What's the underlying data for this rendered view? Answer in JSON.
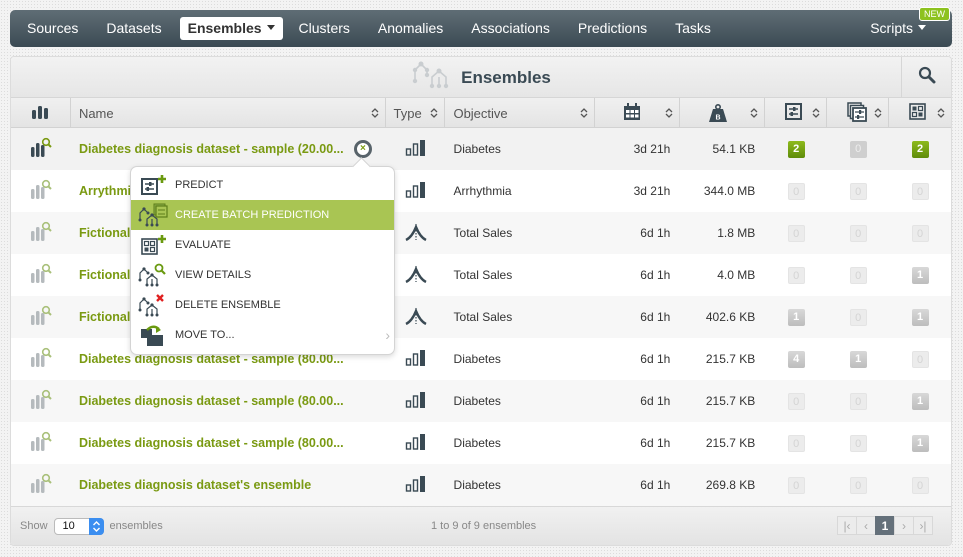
{
  "nav": {
    "items": [
      {
        "label": "Sources",
        "active": false
      },
      {
        "label": "Datasets",
        "active": false
      },
      {
        "label": "Ensembles",
        "active": true
      },
      {
        "label": "Clusters",
        "active": false
      },
      {
        "label": "Anomalies",
        "active": false
      },
      {
        "label": "Associations",
        "active": false
      },
      {
        "label": "Predictions",
        "active": false
      },
      {
        "label": "Tasks",
        "active": false
      }
    ],
    "scripts_label": "Scripts",
    "new_badge": "NEW"
  },
  "panel": {
    "title": "Ensembles",
    "search_icon": "search-icon"
  },
  "table": {
    "headers": {
      "name": "Name",
      "type": "Type",
      "objective": "Objective",
      "age_icon": "calendar-icon",
      "size_icon": "weight-icon",
      "predictions_icon": "prediction-icon",
      "batch_icon": "batch-prediction-icon",
      "evaluations_icon": "evaluation-icon",
      "size_icon_letter": "B"
    },
    "rows": [
      {
        "name": "Diabetes diagnosis dataset - sample (20.00...",
        "type": "classification",
        "objective": "Diabetes",
        "age": "3d 21h",
        "size": "54.1 KB",
        "predictions": "2",
        "batch": "0",
        "evaluations": "2"
      },
      {
        "name": "Arrythmia",
        "type": "classification",
        "objective": "Arrhythmia",
        "age": "3d 21h",
        "size": "344.0 MB",
        "predictions": "0",
        "batch": "0",
        "evaluations": "0"
      },
      {
        "name": "Fictional",
        "type": "regression",
        "objective": "Total Sales",
        "age": "6d 1h",
        "size": "1.8 MB",
        "predictions": "0",
        "batch": "0",
        "evaluations": "0"
      },
      {
        "name": "Fictional",
        "type": "regression",
        "objective": "Total Sales",
        "age": "6d 1h",
        "size": "4.0 MB",
        "predictions": "0",
        "batch": "0",
        "evaluations": "1"
      },
      {
        "name": "Fictional",
        "type": "regression",
        "objective": "Total Sales",
        "age": "6d 1h",
        "size": "402.6 KB",
        "predictions": "1",
        "batch": "0",
        "evaluations": "1"
      },
      {
        "name": "Diabetes diagnosis dataset - sample (80.00...",
        "type": "classification",
        "objective": "Diabetes",
        "age": "6d 1h",
        "size": "215.7 KB",
        "predictions": "4",
        "batch": "1",
        "evaluations": "0"
      },
      {
        "name": "Diabetes diagnosis dataset - sample (80.00...",
        "type": "classification",
        "objective": "Diabetes",
        "age": "6d 1h",
        "size": "215.7 KB",
        "predictions": "0",
        "batch": "0",
        "evaluations": "1"
      },
      {
        "name": "Diabetes diagnosis dataset - sample (80.00...",
        "type": "classification",
        "objective": "Diabetes",
        "age": "6d 1h",
        "size": "215.7 KB",
        "predictions": "0",
        "batch": "0",
        "evaluations": "1"
      },
      {
        "name": "Diabetes diagnosis dataset's ensemble",
        "type": "classification",
        "objective": "Diabetes",
        "age": "6d 1h",
        "size": "269.8 KB",
        "predictions": "0",
        "batch": "0",
        "evaluations": "0"
      }
    ]
  },
  "context_menu": {
    "items": [
      {
        "label": "PREDICT",
        "icon": "predict-icon",
        "active": false
      },
      {
        "label": "CREATE BATCH PREDICTION",
        "icon": "batch-prediction-icon",
        "active": true
      },
      {
        "label": "EVALUATE",
        "icon": "evaluate-icon",
        "active": false
      },
      {
        "label": "VIEW DETAILS",
        "icon": "view-details-icon",
        "active": false
      },
      {
        "label": "DELETE ENSEMBLE",
        "icon": "delete-ensemble-icon",
        "active": false
      },
      {
        "label": "MOVE TO...",
        "icon": "move-to-icon",
        "active": false,
        "submenu": true
      }
    ]
  },
  "footer": {
    "show_label": "Show",
    "page_size": "10",
    "unit_label": "ensembles",
    "range_text": "1 to 9 of 9 ensembles",
    "current_page": "1"
  },
  "colors": {
    "accent_green": "#7a9a12",
    "menu_active": "#a9c553",
    "nav_bg": "#4a5962"
  }
}
